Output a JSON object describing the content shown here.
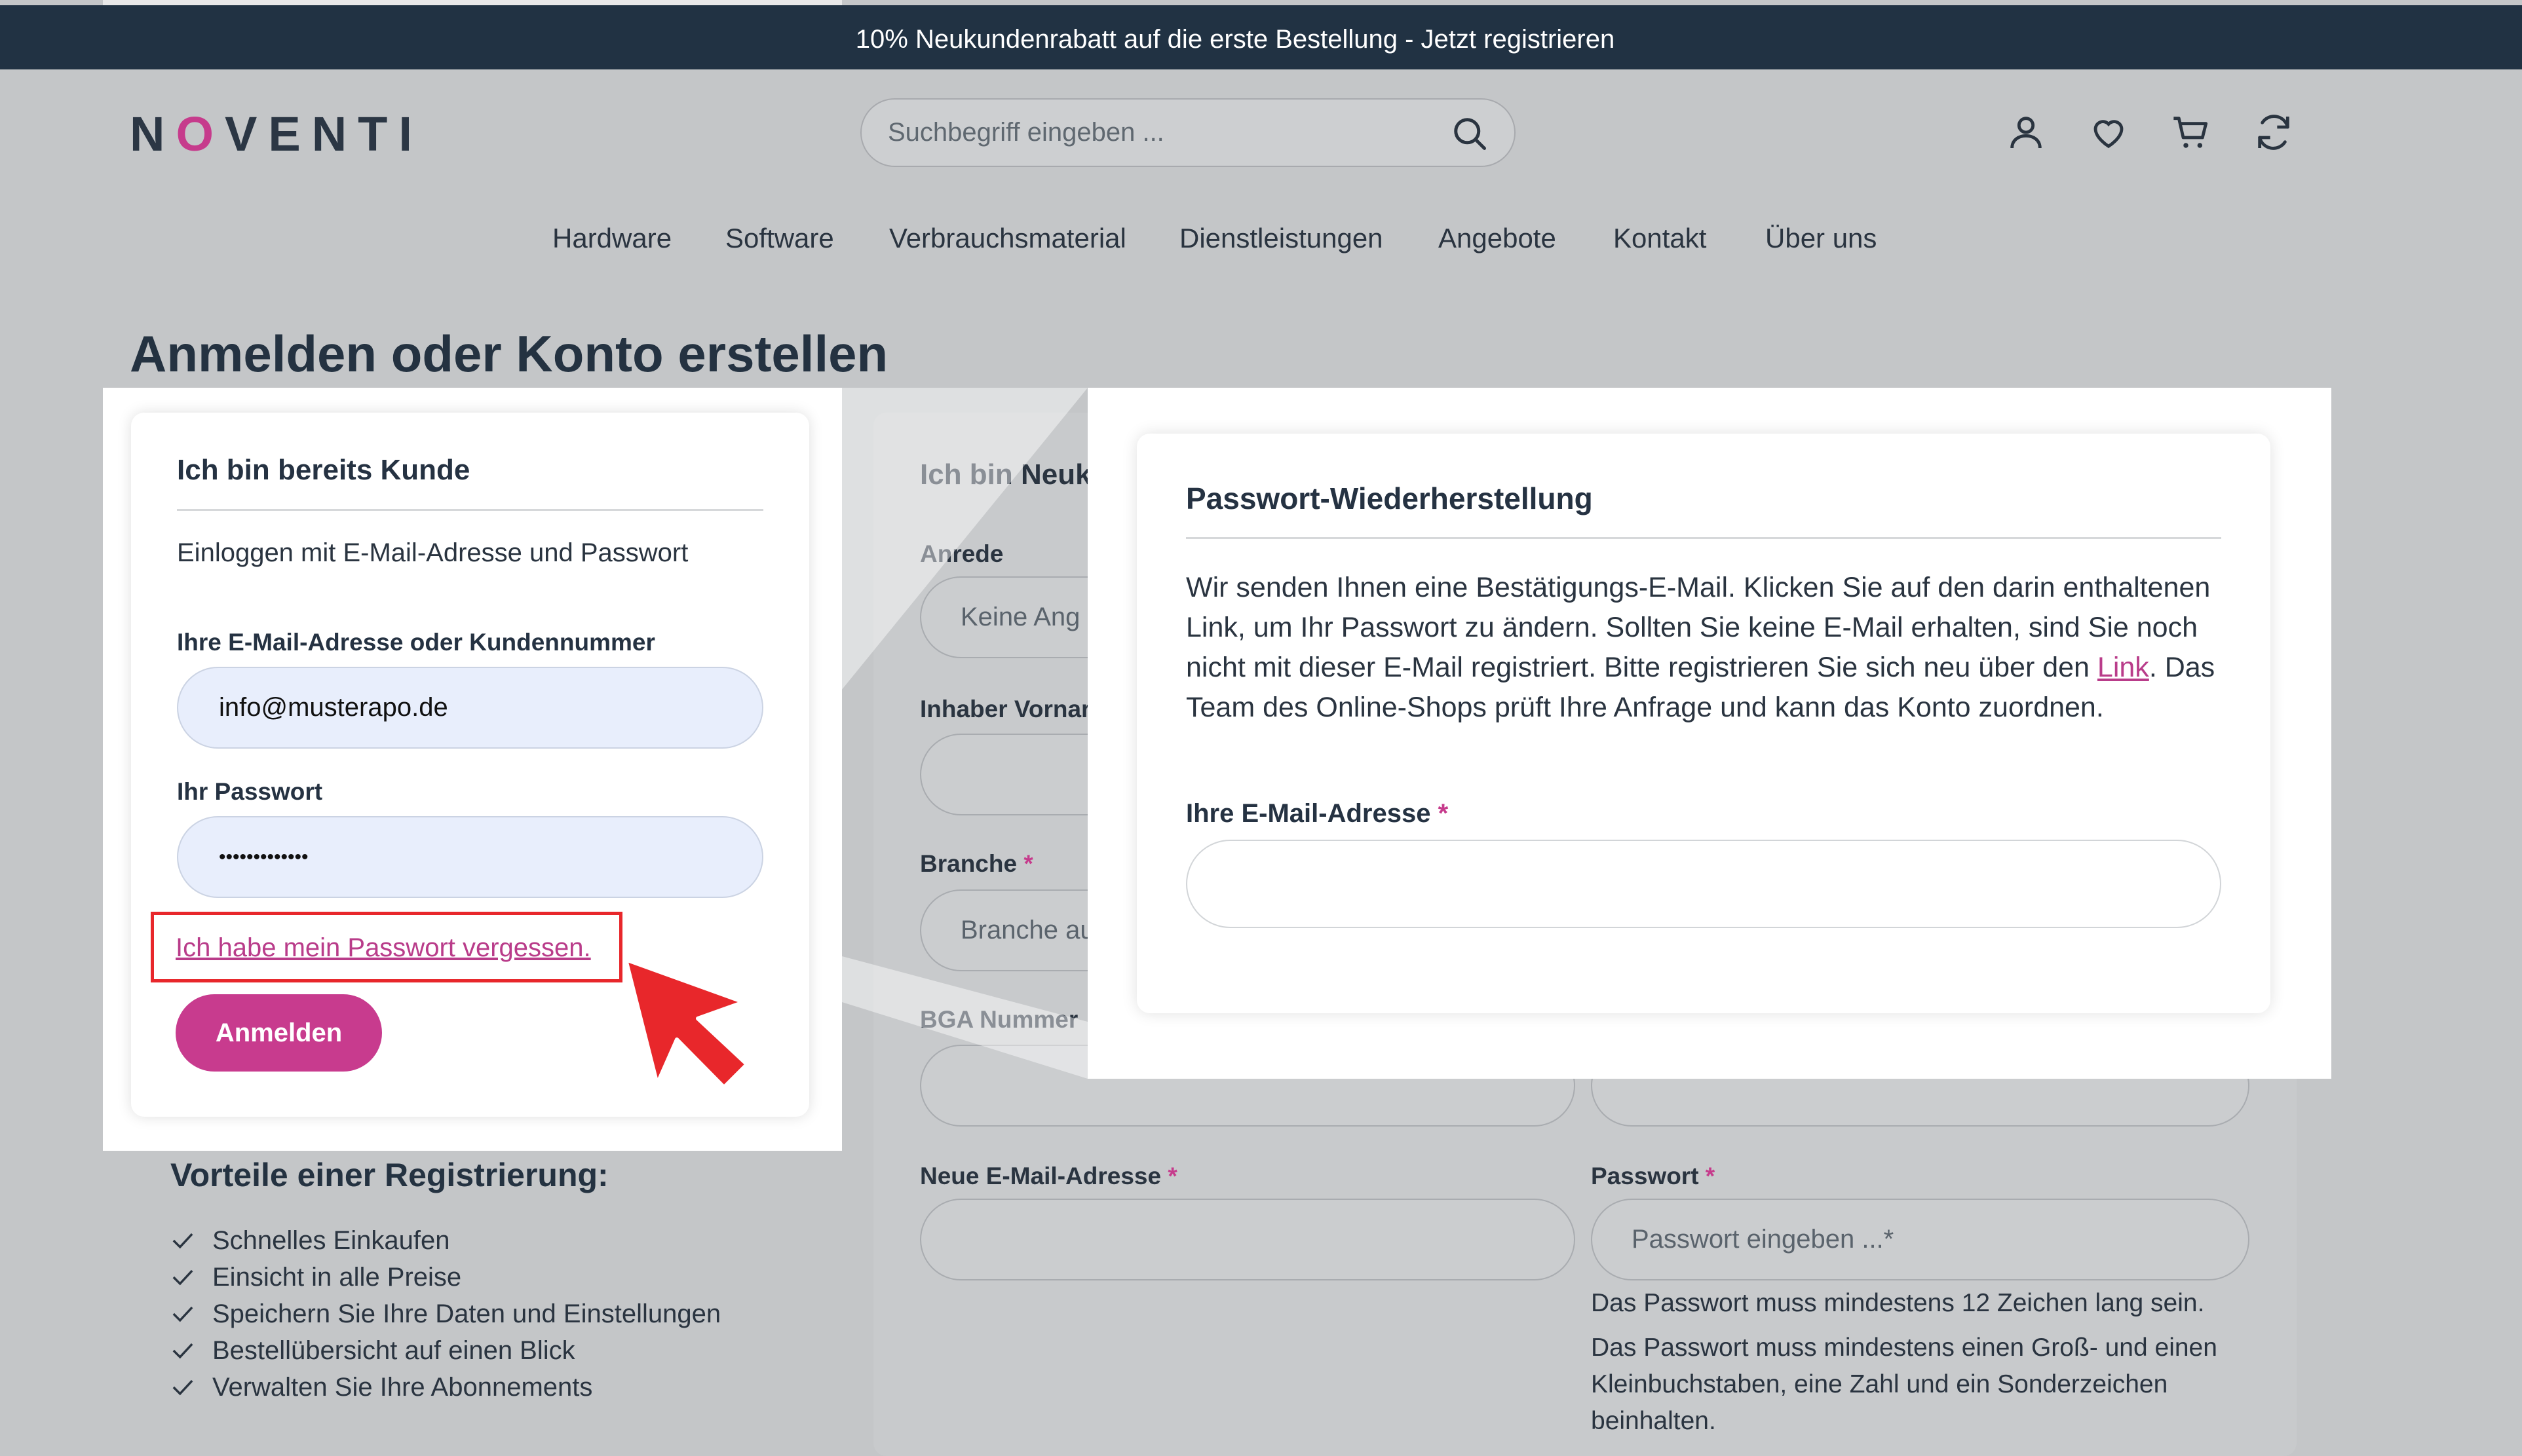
{
  "topbar": {
    "promo": "10% Neukundenrabatt auf die erste Bestellung - Jetzt registrieren"
  },
  "header": {
    "logo_parts": [
      "N",
      "O",
      "VENTI"
    ],
    "search_placeholder": "Suchbegriff eingeben ...",
    "icons": [
      "user-icon",
      "heart-icon",
      "cart-icon",
      "refresh-icon"
    ]
  },
  "nav": [
    "Hardware",
    "Software",
    "Verbrauchsmaterial",
    "Dienstleistungen",
    "Angebote",
    "Kontakt",
    "Über uns"
  ],
  "page_title": "Anmelden oder Konto erstellen",
  "login": {
    "heading": "Ich bin bereits Kunde",
    "subtitle": "Einloggen mit E-Mail-Adresse und Passwort",
    "email_label": "Ihre E-Mail-Adresse oder Kundennummer",
    "email_value": "info@musterapo.de",
    "password_label": "Ihr Passwort",
    "password_value": "•••••••••••••",
    "forgot_link": "Ich habe mein Passwort vergessen.",
    "submit": "Anmelden"
  },
  "register": {
    "heading": "Ich bin Neuk",
    "salutation_label": "Anrede",
    "salutation_value": "Keine Ang",
    "owner_label": "Inhaber Vornar",
    "branch_label": "Branche",
    "branch_value": "Branche au",
    "bga_label": "BGA Nummer",
    "email_label": "Neue E-Mail-Adresse",
    "password_label": "Passwort",
    "password_placeholder": "Passwort eingeben ...*",
    "pw_hint_1": "Das Passwort muss mindestens 12 Zeichen lang sein.",
    "pw_hint_2": "Das Passwort muss mindestens einen Groß- und einen Kleinbuchstaben, eine Zahl und ein Sonderzeichen beinhalten.",
    "required_mark": "*"
  },
  "recovery": {
    "heading": "Passwort-Wiederherstellung",
    "text_before": "Wir senden Ihnen eine Bestätigungs-E-Mail. Klicken Sie auf den darin enthaltenen Link, um Ihr Passwort zu ändern. Sollten Sie keine E-Mail erhalten, sind Sie noch nicht mit dieser E-Mail registriert. Bitte registrieren Sie sich neu über den ",
    "link": "Link",
    "text_after": ". Das Team des Online-Shops prüft Ihre Anfrage und kann das Konto zuordnen.",
    "email_label": "Ihre E-Mail-Adresse",
    "required_mark": "*"
  },
  "benefits": {
    "heading": "Vorteile einer Registrierung:",
    "items": [
      "Schnelles Einkaufen",
      "Einsicht in alle Preise",
      "Speichern Sie Ihre Daten und Einstellungen",
      "Bestellübersicht auf einen Blick",
      "Verwalten Sie Ihre Abonnements"
    ]
  },
  "colors": {
    "brand": "#c63b8c",
    "dark": "#213243",
    "highlight_border": "#e8272b"
  }
}
